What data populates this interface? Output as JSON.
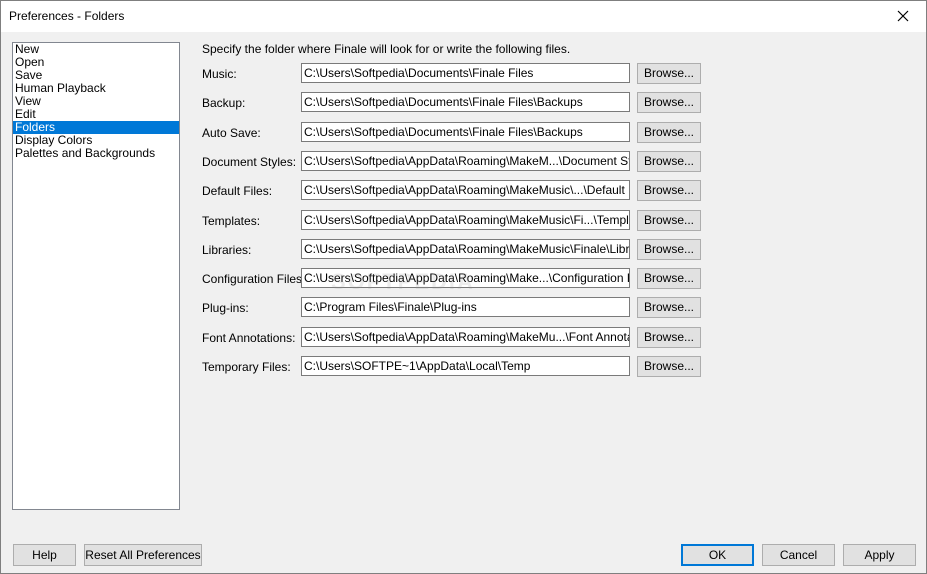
{
  "window": {
    "title": "Preferences - Folders"
  },
  "categories": [
    {
      "label": "New",
      "selected": false
    },
    {
      "label": "Open",
      "selected": false
    },
    {
      "label": "Save",
      "selected": false
    },
    {
      "label": "Human Playback",
      "selected": false
    },
    {
      "label": "View",
      "selected": false
    },
    {
      "label": "Edit",
      "selected": false
    },
    {
      "label": "Folders",
      "selected": true
    },
    {
      "label": "Display Colors",
      "selected": false
    },
    {
      "label": "Palettes and Backgrounds",
      "selected": false
    }
  ],
  "instructions": "Specify the folder where Finale will look for or write the following files.",
  "browse_label": "Browse...",
  "folders": [
    {
      "label": "Music:",
      "path": "C:\\Users\\Softpedia\\Documents\\Finale Files"
    },
    {
      "label": "Backup:",
      "path": "C:\\Users\\Softpedia\\Documents\\Finale Files\\Backups"
    },
    {
      "label": "Auto Save:",
      "path": "C:\\Users\\Softpedia\\Documents\\Finale Files\\Backups"
    },
    {
      "label": "Document Styles:",
      "path": "C:\\Users\\Softpedia\\AppData\\Roaming\\MakeM...\\Document Styles"
    },
    {
      "label": "Default Files:",
      "path": "C:\\Users\\Softpedia\\AppData\\Roaming\\MakeMusic\\...\\Default Files"
    },
    {
      "label": "Templates:",
      "path": "C:\\Users\\Softpedia\\AppData\\Roaming\\MakeMusic\\Fi...\\Templates"
    },
    {
      "label": "Libraries:",
      "path": "C:\\Users\\Softpedia\\AppData\\Roaming\\MakeMusic\\Finale\\Libraries"
    },
    {
      "label": "Configuration Files:",
      "path": "C:\\Users\\Softpedia\\AppData\\Roaming\\Make...\\Configuration Files"
    },
    {
      "label": "Plug-ins:",
      "path": "C:\\Program Files\\Finale\\Plug-ins"
    },
    {
      "label": "Font Annotations:",
      "path": "C:\\Users\\Softpedia\\AppData\\Roaming\\MakeMu...\\Font Annotation"
    },
    {
      "label": "Temporary Files:",
      "path": "C:\\Users\\SOFTPE~1\\AppData\\Local\\Temp"
    }
  ],
  "buttons": {
    "help": "Help",
    "reset": "Reset All Preferences",
    "ok": "OK",
    "cancel": "Cancel",
    "apply": "Apply"
  },
  "watermark": "SOFTPEDIA",
  "colors": {
    "selection": "#0078d7",
    "dialog_bg": "#f0f0f0"
  },
  "icons": {
    "close": "close-icon"
  }
}
